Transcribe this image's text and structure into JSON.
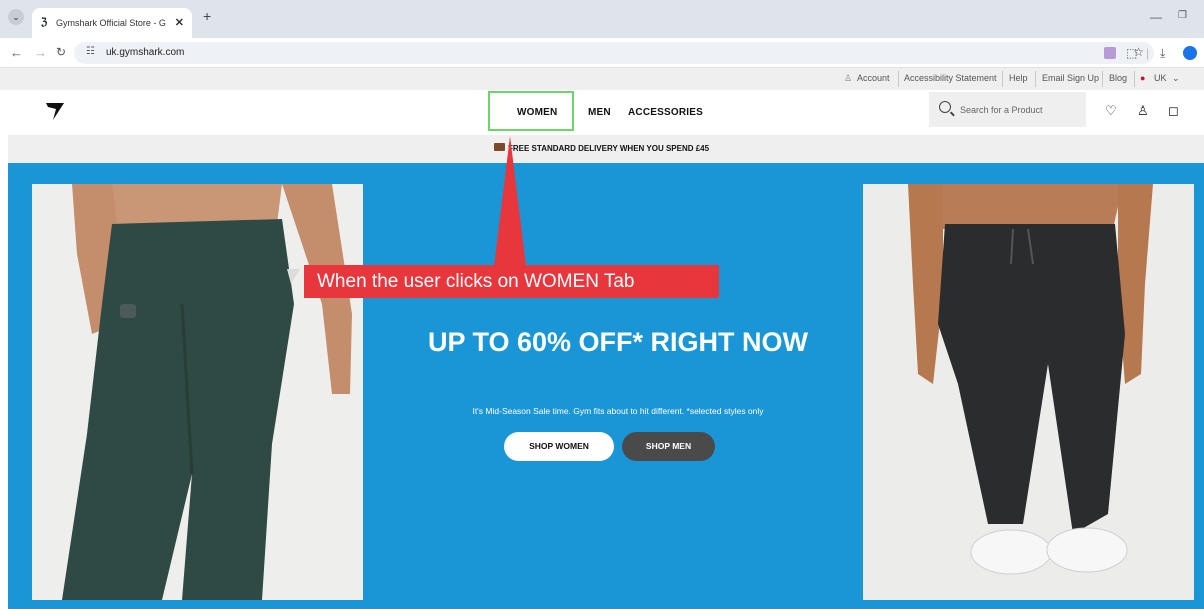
{
  "browser": {
    "tab_title": "Gymshark Official Store - Gym",
    "new_tab": "+",
    "url": "uk.gymshark.com",
    "window_minimize": "—",
    "window_restore": "❐"
  },
  "utility_bar": {
    "account": "Account",
    "accessibility": "Accessibility Statement",
    "help": "Help",
    "email_signup": "Email Sign Up",
    "blog": "Blog",
    "region": "UK"
  },
  "header": {
    "nav": [
      "WOMEN",
      "MEN",
      "ACCESSORIES"
    ],
    "search_placeholder": "Search for a Product"
  },
  "promo": {
    "text": "FREE STANDARD DELIVERY WHEN YOU SPEND £45"
  },
  "hero": {
    "title": "UP TO 60% OFF* RIGHT NOW",
    "subtitle": "It's Mid-Season Sale time. Gym fits about to hit different. *selected styles only",
    "shop_women": "SHOP WOMEN",
    "shop_men": "SHOP MEN"
  },
  "annotation": {
    "text": "When the user clicks on WOMEN Tab",
    "color": "#e8363d",
    "highlight_color": "#6cd46b"
  },
  "colors": {
    "hero_bg": "#1a96d7",
    "leggings": "#2f4a44",
    "joggers": "#2b2c2e"
  }
}
